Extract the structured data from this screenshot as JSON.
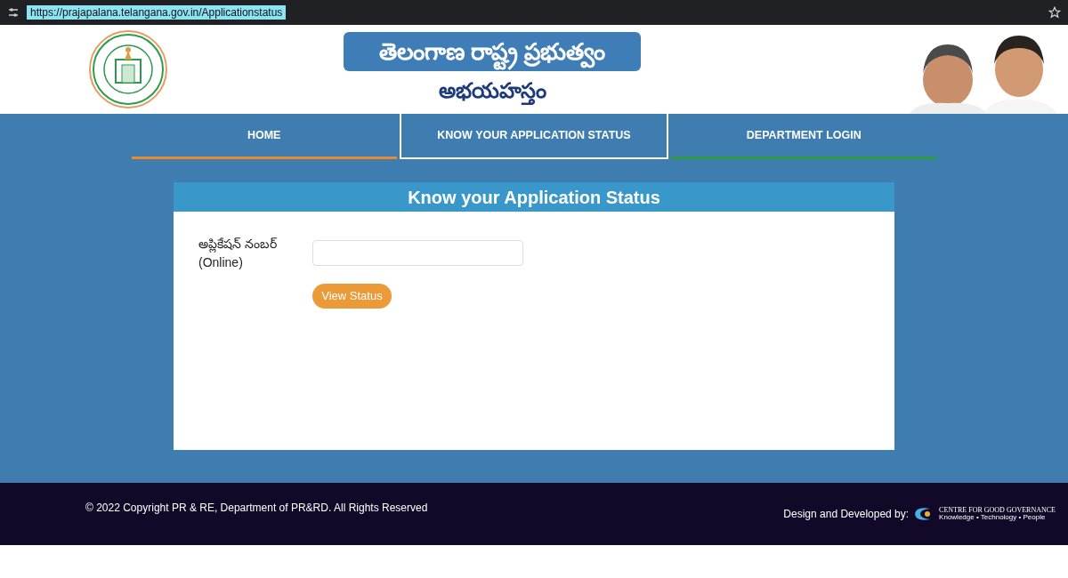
{
  "browser": {
    "url": "https://prajapalana.telangana.gov.in/Applicationstatus"
  },
  "header": {
    "title": "తెలంగాణ రాష్ట్ర ప్రభుత్వం",
    "subtitle": "అభయహస్తం"
  },
  "nav": [
    {
      "label": "HOME",
      "selected": false,
      "color": "#e88a2e"
    },
    {
      "label": "KNOW YOUR APPLICATION STATUS",
      "selected": true,
      "color": "#ffffff"
    },
    {
      "label": "DEPARTMENT LOGIN",
      "selected": false,
      "color": "#2e9a3e"
    }
  ],
  "card": {
    "title": "Know your Application Status",
    "field_label": "అప్లికేషన్ నంబర్",
    "field_sublabel": "(Online)",
    "button": "View Status"
  },
  "footer": {
    "copyright": "© 2022 Copyright PR & RE, Department of PR&RD. All Rights Reserved",
    "credit": "Design and Developed by:",
    "org_name": "CENTRE FOR GOOD GOVERNANCE",
    "org_tagline": "Knowledge • Technology • People"
  }
}
